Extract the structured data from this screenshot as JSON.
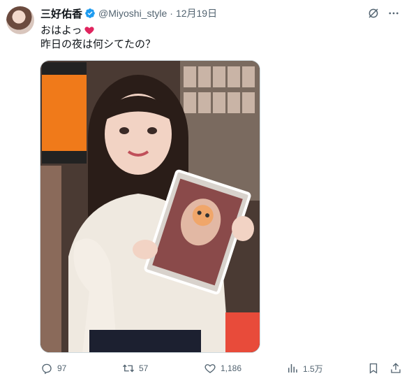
{
  "user": {
    "display_name": "三好佑香",
    "handle": "@Miyoshi_style",
    "separator": "·",
    "date": "12月19日"
  },
  "tweet": {
    "line1": "おはよっ",
    "line2": "昨日の夜は何シてたの？"
  },
  "actions": {
    "replies": "97",
    "reposts": "57",
    "likes": "1,186",
    "views": "1.5万"
  },
  "colors": {
    "text": "#0f1419",
    "muted": "#536471",
    "verified": "#1d9bf0",
    "border": "#cfd9de"
  }
}
